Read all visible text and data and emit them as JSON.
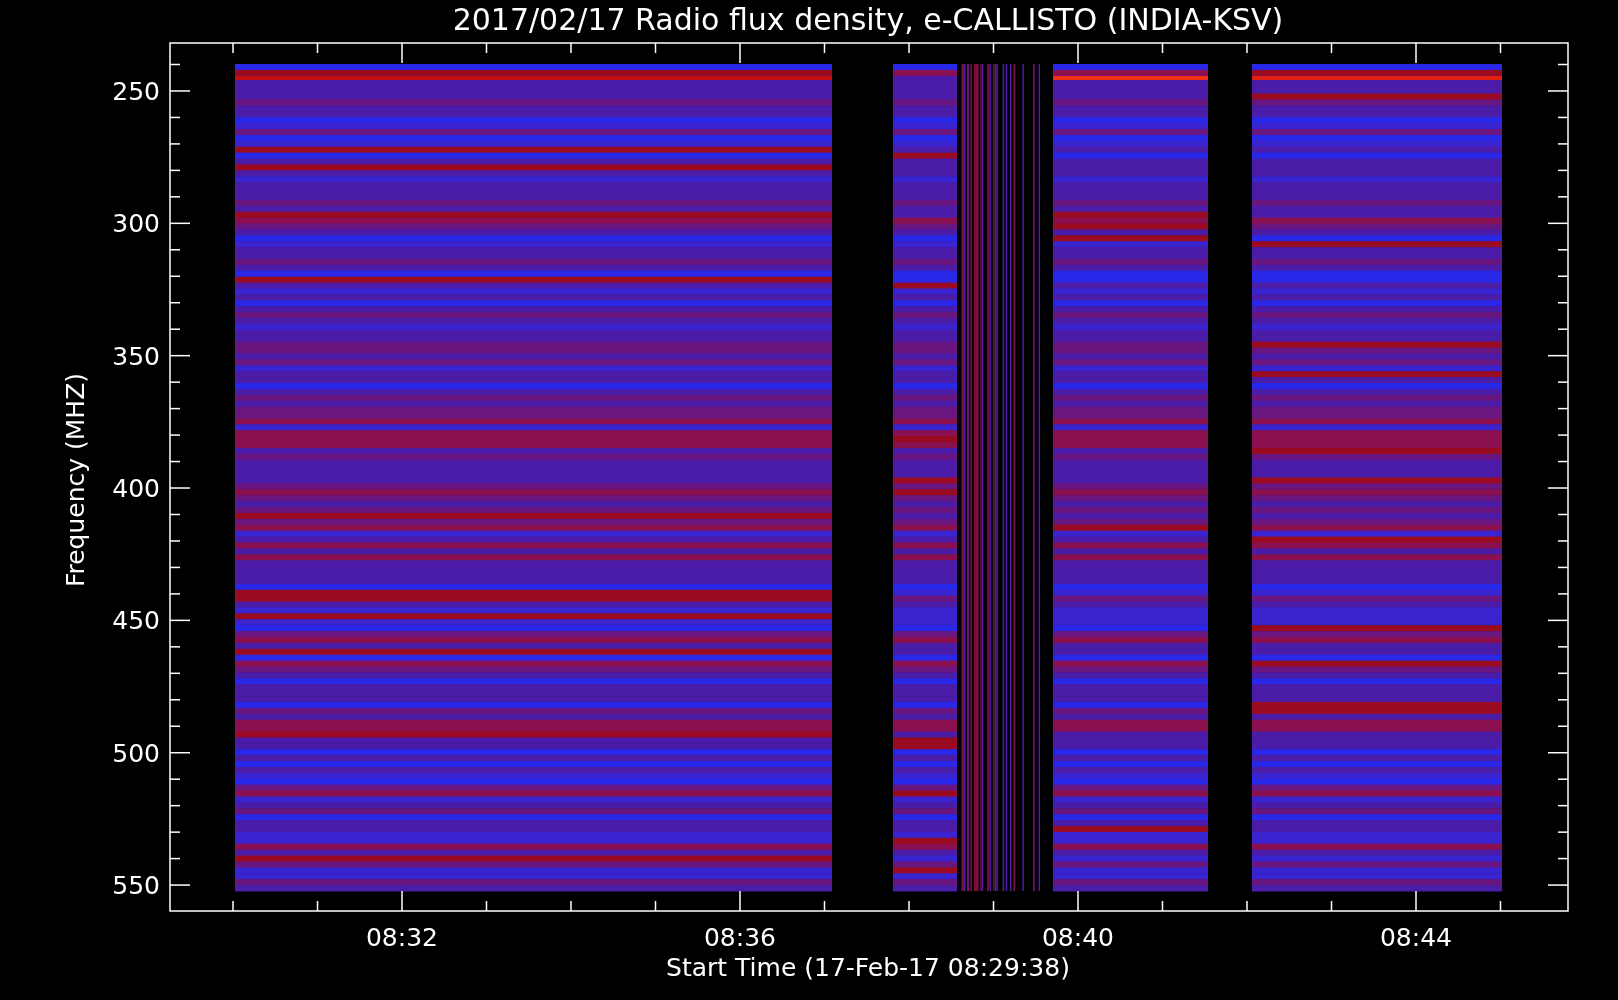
{
  "title": "2017/02/17  Radio flux density, e-CALLISTO (INDIA-KSV)",
  "y_axis": {
    "label": "Frequency (MHZ)",
    "ticks": [
      "250",
      "300",
      "350",
      "400",
      "450",
      "500",
      "550"
    ]
  },
  "x_axis": {
    "label": "Start Time (17-Feb-17 08:29:38)",
    "ticks": [
      "08:32",
      "08:36",
      "08:40",
      "08:44"
    ]
  }
}
